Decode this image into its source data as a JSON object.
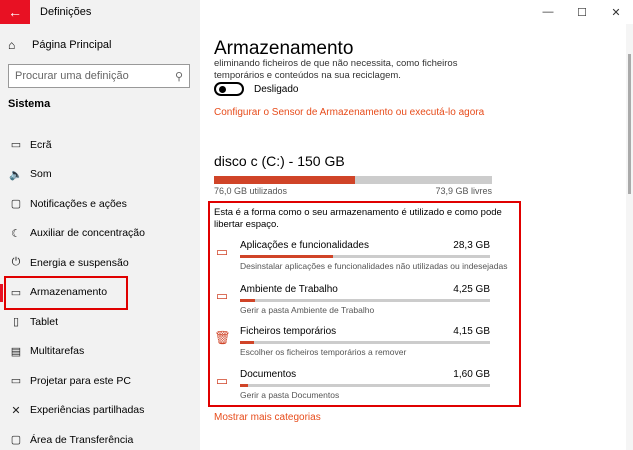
{
  "window": {
    "title": "Definições",
    "back_glyph": "←",
    "minimize_glyph": "—",
    "maximize_glyph": "☐",
    "close_glyph": "✕"
  },
  "sidebar": {
    "home_label": "Página Principal",
    "search_placeholder": "Procurar uma definição",
    "section_title": "Sistema",
    "items": [
      {
        "label": "Ecrã",
        "icon": "monitor-icon",
        "glyph": "▭"
      },
      {
        "label": "Som",
        "icon": "speaker-icon",
        "glyph": "🔈"
      },
      {
        "label": "Notificações e ações",
        "icon": "notification-icon",
        "glyph": "▢"
      },
      {
        "label": "Auxiliar de concentração",
        "icon": "moon-icon",
        "glyph": "☾"
      },
      {
        "label": "Energia e suspensão",
        "icon": "power-icon",
        "glyph": "⏻"
      },
      {
        "label": "Armazenamento",
        "icon": "storage-icon",
        "glyph": "▭"
      },
      {
        "label": "Tablet",
        "icon": "tablet-icon",
        "glyph": "▯"
      },
      {
        "label": "Multitarefas",
        "icon": "multitask-icon",
        "glyph": "▤"
      },
      {
        "label": "Projetar para este PC",
        "icon": "project-icon",
        "glyph": "▭"
      },
      {
        "label": "Experiências partilhadas",
        "icon": "share-icon",
        "glyph": "✕"
      },
      {
        "label": "Área de Transferência",
        "icon": "clipboard-icon",
        "glyph": "▢"
      }
    ],
    "active_index": 5
  },
  "main": {
    "title": "Armazenamento",
    "description": "eliminando ficheiros de que não necessita, como ficheiros temporários e conteúdos na sua reciclagem.",
    "toggle_label": "Desligado",
    "config_link": "Configurar o Sensor de Armazenamento ou executá-lo agora",
    "disk": {
      "title": "disco c (C:) - 150 GB",
      "used_label": "76,0 GB utilizados",
      "free_label": "73,9 GB livres",
      "used_fraction": 0.507
    },
    "intro": "Esta é a forma como o seu armazenamento é utilizado e como pode libertar espaço.",
    "categories": [
      {
        "name": "Aplicações e funcionalidades",
        "size": "28,3 GB",
        "sub": "Desinstalar aplicações e funcionalidades não utilizadas ou indesejadas",
        "fraction": 0.37,
        "icon": "monitor-icon",
        "glyph": "▭"
      },
      {
        "name": "Ambiente de Trabalho",
        "size": "4,25 GB",
        "sub": "Gerir a pasta Ambiente de Trabalho",
        "fraction": 0.06,
        "icon": "desktop-icon",
        "glyph": "▭"
      },
      {
        "name": "Ficheiros temporários",
        "size": "4,15 GB",
        "sub": "Escolher os ficheiros temporários a remover",
        "fraction": 0.055,
        "icon": "trash-icon",
        "glyph": "🗑"
      },
      {
        "name": "Documentos",
        "size": "1,60 GB",
        "sub": "Gerir a pasta Documentos",
        "fraction": 0.03,
        "icon": "folder-icon",
        "glyph": "▭"
      }
    ],
    "more_link": "Mostrar mais categorias"
  },
  "colors": {
    "accent": "#d04428",
    "link": "#e74c1b",
    "highlight": "#e00000"
  }
}
